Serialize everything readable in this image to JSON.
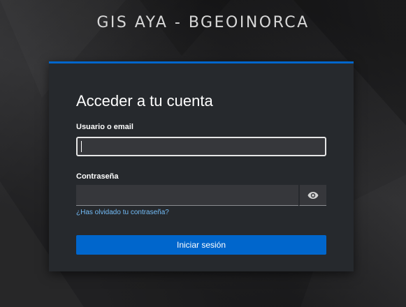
{
  "brand": {
    "title": "GIS AYA - BGEOINORCA"
  },
  "login": {
    "heading": "Acceder a tu cuenta",
    "username_label": "Usuario o email",
    "username_value": "",
    "password_label": "Contraseña",
    "password_value": "",
    "show_password_icon": "eye-icon",
    "forgot_link": "¿Has olvidado tu contraseña?",
    "submit_label": "Iniciar sesión"
  },
  "colors": {
    "accent": "#0066cc",
    "link": "#73bcf7",
    "card_bg": "#26292d",
    "input_bg": "#36373b",
    "page_bg": "#232325"
  }
}
